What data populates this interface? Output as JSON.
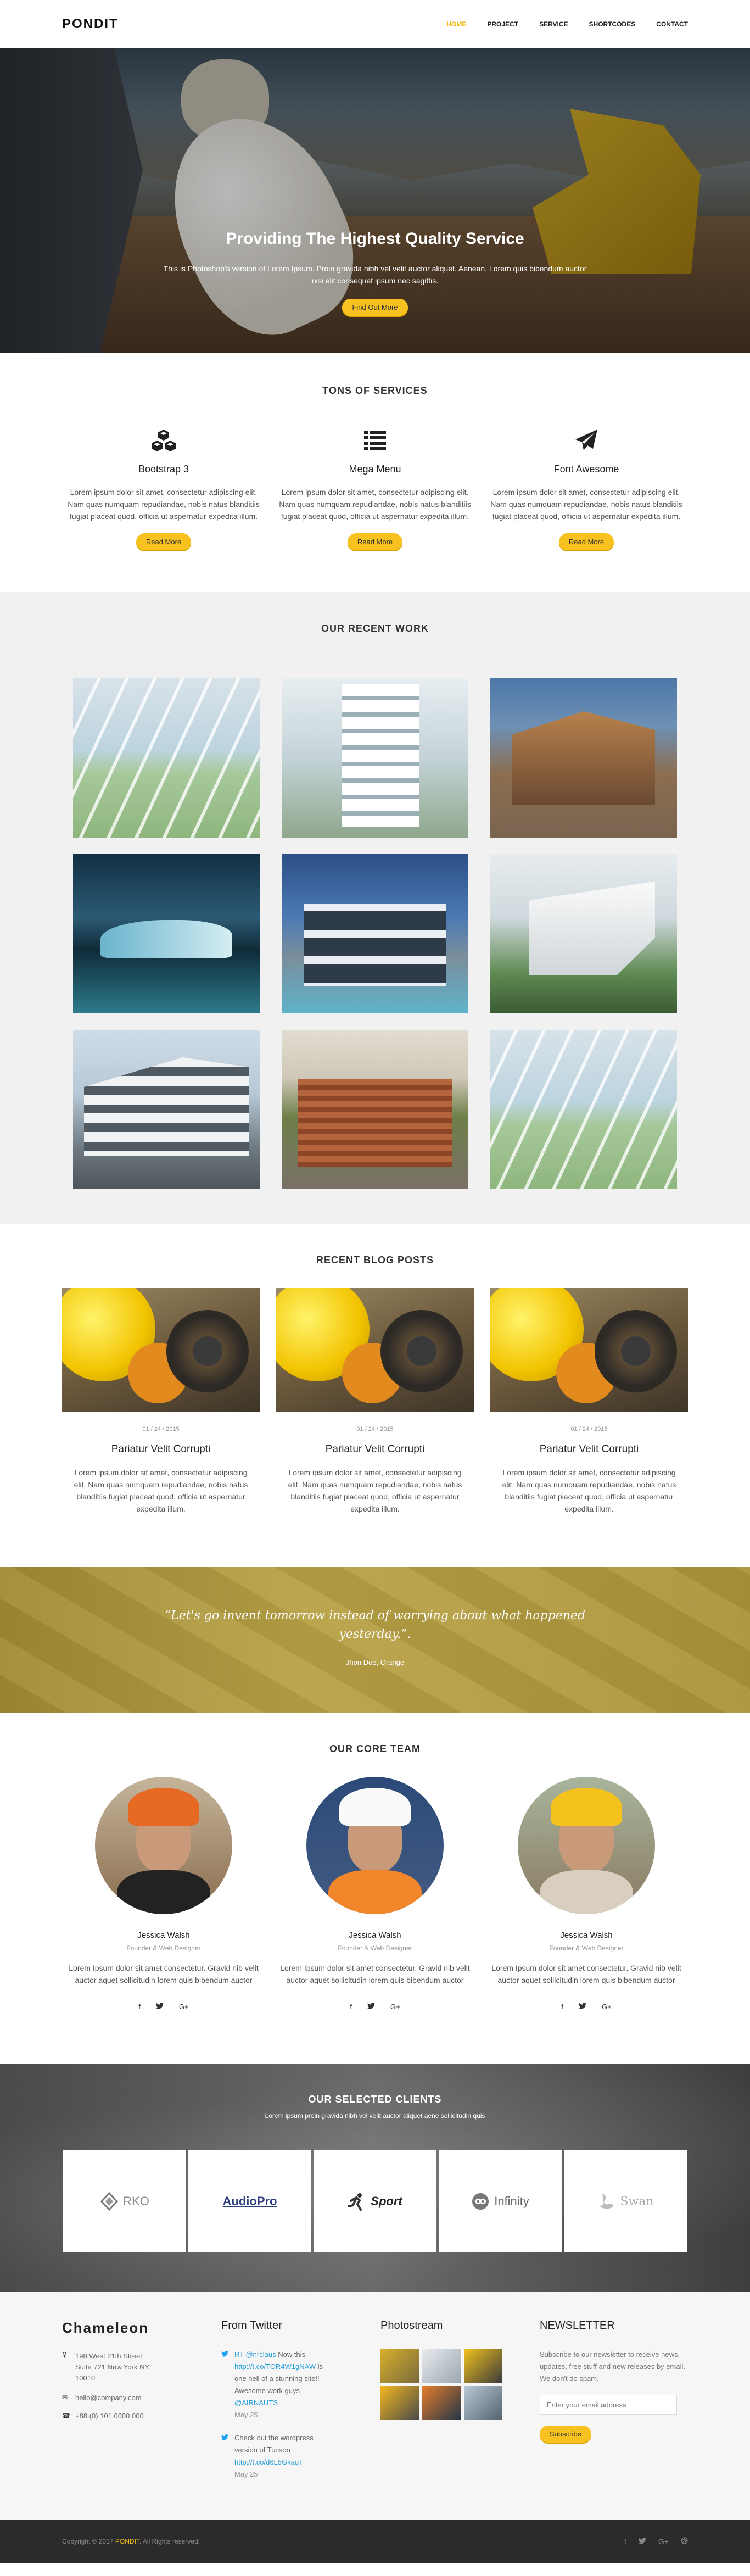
{
  "header": {
    "logo": "PONDIT",
    "nav": [
      {
        "label": "HOME"
      },
      {
        "label": "PROJECT"
      },
      {
        "label": "SERVICE"
      },
      {
        "label": "SHORTCODES"
      },
      {
        "label": "CONTACT"
      }
    ],
    "active_color": "#f4b400"
  },
  "hero": {
    "title": "Providing The Highest Quality Service",
    "text": "This is Photoshop's version of Lorem Ipsum. Proin gravida nibh vel velit auctor aliquet. Aenean, Lorem quis bibendum auctor nisi elit consequat ipsum nec sagittis.",
    "button": "Find Out More"
  },
  "services": {
    "title": "TONS OF SERVICES",
    "items": [
      {
        "icon": "cubes-icon",
        "title": "Bootstrap 3",
        "text": "Lorem ipsum dolor sit amet, consectetur adipiscing elit. Nam quas numquam repudiandae, nobis natus blanditiis fugiat placeat quod, officia ut aspernatur expedita illum.",
        "button": "Read More"
      },
      {
        "icon": "list-icon",
        "title": "Mega Menu",
        "text": "Lorem ipsum dolor sit amet, consectetur adipiscing elit. Nam quas numquam repudiandae, nobis natus blanditiis fugiat placeat quod, officia ut aspernatur expedita illum.",
        "button": "Read More"
      },
      {
        "icon": "paper-plane-icon",
        "title": "Font Awesome",
        "text": "Lorem ipsum dolor sit amet, consectetur adipiscing elit. Nam quas numquam repudiandae, nobis natus blanditiis fugiat placeat quod, officia ut aspernatur expedita illum.",
        "button": "Read More"
      }
    ]
  },
  "work": {
    "title": "OUR RECENT WORK"
  },
  "blog": {
    "title": "RECENT BLOG POSTS",
    "posts": [
      {
        "date": "01 / 24 / 2015",
        "title": "Pariatur Velit Corrupti",
        "text": "Lorem ipsum dolor sit amet, consectetur adipiscing elit. Nam quas numquam repudiandae, nobis natus blanditiis fugiat placeat quod, officia ut aspernatur expedita illum."
      },
      {
        "date": "01 / 24 / 2015",
        "title": "Pariatur Velit Corrupti",
        "text": "Lorem ipsum dolor sit amet, consectetur adipiscing elit. Nam quas numquam repudiandae, nobis natus blanditiis fugiat placeat quod, officia ut aspernatur expedita illum."
      },
      {
        "date": "01 / 24 / 2015",
        "title": "Pariatur Velit Corrupti",
        "text": "Lorem ipsum dolor sit amet, consectetur adipiscing elit. Nam quas numquam repudiandae, nobis natus blanditiis fugiat placeat quod, officia ut aspernatur expedita illum."
      }
    ]
  },
  "quote": {
    "text": "“Let's go invent tomorrow instead of worrying about what happened yesterday.”.",
    "author": "Jhon Doe, Orange"
  },
  "team": {
    "title": "OUR CORE TEAM",
    "members": [
      {
        "name": "Jessica Walsh",
        "role": "Founder & Web Designer",
        "text": "Lorem Ipsum dolor sit amet consectetur. Gravid nib velit auctor aquet sollicitudin lorem quis bibendum auctor"
      },
      {
        "name": "Jessica Walsh",
        "role": "Founder & Web Designer",
        "text": "Lorem Ipsum dolor sit amet consectetur. Gravid nib velit auctor aquet sollicitudin lorem quis bibendum auctor"
      },
      {
        "name": "Jessica Walsh",
        "role": "Founder & Web Designer",
        "text": "Lorem Ipsum dolor sit amet consectetur. Gravid nib velit auctor aquet sollicitudin lorem quis bibendum auctor"
      }
    ],
    "social": {
      "facebook": "f",
      "twitter": "✦",
      "google": "G+"
    }
  },
  "clients": {
    "title": "OUR SELECTED CLIENTS",
    "subtitle": "Lorem ipsum proin gravida nibh vel velit auctor aliquet aene sollicitudin quis",
    "logos": [
      {
        "name": "RKO"
      },
      {
        "name": "AudioPro"
      },
      {
        "name": "Sport"
      },
      {
        "name": "Infinity"
      },
      {
        "name": "Swan"
      }
    ]
  },
  "footer": {
    "brand": "Chameleon",
    "address": "198 West 21th Street Suite 721 New York NY 10010",
    "email": "hello@company.com",
    "phone": "+88 (0) 101 0000 000",
    "twitter_title": "From Twitter",
    "tweets": [
      {
        "handle": "RT @nrclaus",
        "pre": "Now this",
        "link": "http://t.co/TOR4W1gNAW",
        "post": "is one hell of a stunning site!! Awesome work guys",
        "tag": "@AIRNAUTS",
        "date": "May 25"
      },
      {
        "pre": "Check out the wordpress version of Tucson",
        "link": "http://t.co/d6L5GkaqT",
        "date": "May 25"
      }
    ],
    "photo_title": "Photostream",
    "newsletter_title": "NEWSLETTER",
    "newsletter_text": "Subscribe to our newsletter to receive news, updates, free stuff and new releases by email. We don't do spam.",
    "newsletter_placeholder": "Enter your email address",
    "subscribe": "Subscribe"
  },
  "bottom": {
    "pre": "Copyright © 2017",
    "brand": "PONDIT",
    "post": ". All Rights reserved."
  }
}
